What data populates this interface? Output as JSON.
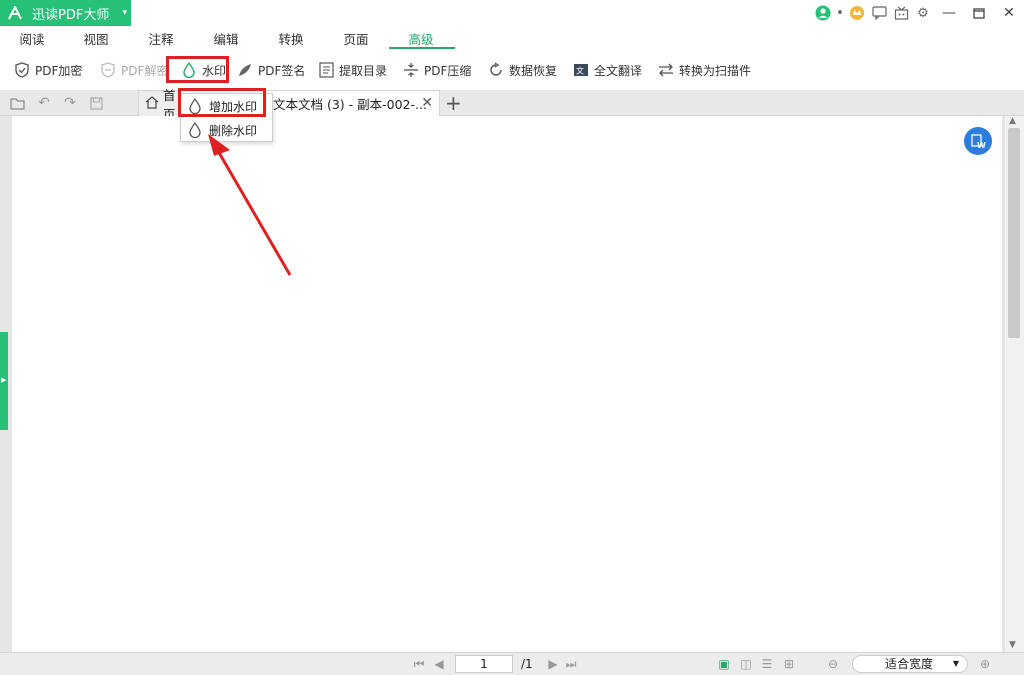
{
  "app": {
    "name": "迅读PDF大师",
    "accent": "#27c077"
  },
  "menu": {
    "tabs": [
      {
        "label": "阅读"
      },
      {
        "label": "视图"
      },
      {
        "label": "注释"
      },
      {
        "label": "编辑"
      },
      {
        "label": "转换"
      },
      {
        "label": "页面"
      },
      {
        "label": "高级",
        "active": true
      }
    ]
  },
  "toolbar": {
    "tools": [
      {
        "label": "PDF加密",
        "icon": "shield-check-icon"
      },
      {
        "label": "PDF解密",
        "icon": "shield-icon",
        "disabled": true
      },
      {
        "label": "水印",
        "icon": "drop-icon"
      },
      {
        "label": "PDF签名",
        "icon": "pen-icon"
      },
      {
        "label": "提取目录",
        "icon": "list-icon"
      },
      {
        "label": "PDF压缩",
        "icon": "compress-icon"
      },
      {
        "label": "数据恢复",
        "icon": "restore-icon"
      },
      {
        "label": "全文翻译",
        "icon": "translate-icon"
      },
      {
        "label": "转换为扫描件",
        "icon": "swap-icon"
      }
    ]
  },
  "tabs": {
    "home_label": "首页",
    "file_label": "文本文档 (3) - 副本-002-...",
    "close_glyph": "✕",
    "add_glyph": "+"
  },
  "dropdown": {
    "items": [
      {
        "label": "增加水印"
      },
      {
        "label": "删除水印"
      }
    ]
  },
  "statusbar": {
    "page_current": "1",
    "page_total": "/1",
    "zoom": "适合宽度"
  },
  "annotation_color": "#e02020"
}
